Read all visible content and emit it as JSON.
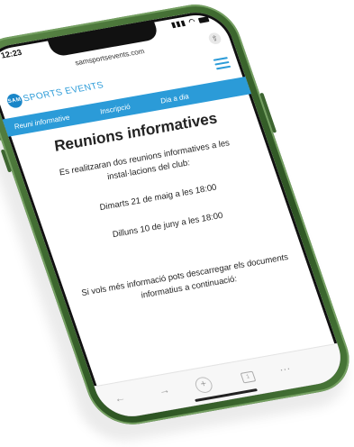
{
  "status": {
    "time": "12:23",
    "signal_icon": "signal-icon",
    "wifi_icon": "wifi-icon",
    "battery_icon": "battery-icon",
    "battery_label": "90"
  },
  "browser": {
    "url": "samsportsevents.com",
    "share_icon": "share-icon"
  },
  "site": {
    "logo_badge": "SAM",
    "logo_text": "SPORTS EVENTS",
    "menu_icon": "hamburger-menu-icon",
    "brand_color": "#2b9bd8",
    "nav": [
      "Reuni informative",
      "Inscripció",
      "Dia a dia"
    ]
  },
  "content": {
    "title": "Reunions informatives",
    "intro": "Es realitzaran dos reunions informatives a les instal·lacions del club:",
    "meeting1": "Dimarts 21 de maig a les 18:00",
    "meeting2": "Dilluns 10 de juny a les 18:00",
    "more_info": "Si vols més informació pots descarregar els documents informatius a continuació:"
  },
  "toolbar": {
    "back": "←",
    "forward": "→",
    "new_tab": "+",
    "tabs": "1",
    "more": "···"
  },
  "phone": {
    "color": "#3f6a30"
  }
}
